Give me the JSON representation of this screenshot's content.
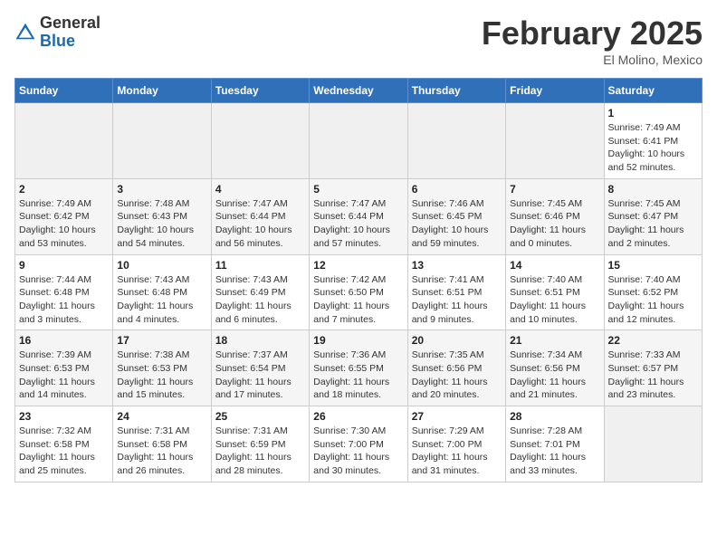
{
  "header": {
    "logo_general": "General",
    "logo_blue": "Blue",
    "title": "February 2025",
    "location": "El Molino, Mexico"
  },
  "days_of_week": [
    "Sunday",
    "Monday",
    "Tuesday",
    "Wednesday",
    "Thursday",
    "Friday",
    "Saturday"
  ],
  "weeks": [
    [
      {
        "day": "",
        "info": ""
      },
      {
        "day": "",
        "info": ""
      },
      {
        "day": "",
        "info": ""
      },
      {
        "day": "",
        "info": ""
      },
      {
        "day": "",
        "info": ""
      },
      {
        "day": "",
        "info": ""
      },
      {
        "day": "1",
        "info": "Sunrise: 7:49 AM\nSunset: 6:41 PM\nDaylight: 10 hours and 52 minutes."
      }
    ],
    [
      {
        "day": "2",
        "info": "Sunrise: 7:49 AM\nSunset: 6:42 PM\nDaylight: 10 hours and 53 minutes."
      },
      {
        "day": "3",
        "info": "Sunrise: 7:48 AM\nSunset: 6:43 PM\nDaylight: 10 hours and 54 minutes."
      },
      {
        "day": "4",
        "info": "Sunrise: 7:47 AM\nSunset: 6:44 PM\nDaylight: 10 hours and 56 minutes."
      },
      {
        "day": "5",
        "info": "Sunrise: 7:47 AM\nSunset: 6:44 PM\nDaylight: 10 hours and 57 minutes."
      },
      {
        "day": "6",
        "info": "Sunrise: 7:46 AM\nSunset: 6:45 PM\nDaylight: 10 hours and 59 minutes."
      },
      {
        "day": "7",
        "info": "Sunrise: 7:45 AM\nSunset: 6:46 PM\nDaylight: 11 hours and 0 minutes."
      },
      {
        "day": "8",
        "info": "Sunrise: 7:45 AM\nSunset: 6:47 PM\nDaylight: 11 hours and 2 minutes."
      }
    ],
    [
      {
        "day": "9",
        "info": "Sunrise: 7:44 AM\nSunset: 6:48 PM\nDaylight: 11 hours and 3 minutes."
      },
      {
        "day": "10",
        "info": "Sunrise: 7:43 AM\nSunset: 6:48 PM\nDaylight: 11 hours and 4 minutes."
      },
      {
        "day": "11",
        "info": "Sunrise: 7:43 AM\nSunset: 6:49 PM\nDaylight: 11 hours and 6 minutes."
      },
      {
        "day": "12",
        "info": "Sunrise: 7:42 AM\nSunset: 6:50 PM\nDaylight: 11 hours and 7 minutes."
      },
      {
        "day": "13",
        "info": "Sunrise: 7:41 AM\nSunset: 6:51 PM\nDaylight: 11 hours and 9 minutes."
      },
      {
        "day": "14",
        "info": "Sunrise: 7:40 AM\nSunset: 6:51 PM\nDaylight: 11 hours and 10 minutes."
      },
      {
        "day": "15",
        "info": "Sunrise: 7:40 AM\nSunset: 6:52 PM\nDaylight: 11 hours and 12 minutes."
      }
    ],
    [
      {
        "day": "16",
        "info": "Sunrise: 7:39 AM\nSunset: 6:53 PM\nDaylight: 11 hours and 14 minutes."
      },
      {
        "day": "17",
        "info": "Sunrise: 7:38 AM\nSunset: 6:53 PM\nDaylight: 11 hours and 15 minutes."
      },
      {
        "day": "18",
        "info": "Sunrise: 7:37 AM\nSunset: 6:54 PM\nDaylight: 11 hours and 17 minutes."
      },
      {
        "day": "19",
        "info": "Sunrise: 7:36 AM\nSunset: 6:55 PM\nDaylight: 11 hours and 18 minutes."
      },
      {
        "day": "20",
        "info": "Sunrise: 7:35 AM\nSunset: 6:56 PM\nDaylight: 11 hours and 20 minutes."
      },
      {
        "day": "21",
        "info": "Sunrise: 7:34 AM\nSunset: 6:56 PM\nDaylight: 11 hours and 21 minutes."
      },
      {
        "day": "22",
        "info": "Sunrise: 7:33 AM\nSunset: 6:57 PM\nDaylight: 11 hours and 23 minutes."
      }
    ],
    [
      {
        "day": "23",
        "info": "Sunrise: 7:32 AM\nSunset: 6:58 PM\nDaylight: 11 hours and 25 minutes."
      },
      {
        "day": "24",
        "info": "Sunrise: 7:31 AM\nSunset: 6:58 PM\nDaylight: 11 hours and 26 minutes."
      },
      {
        "day": "25",
        "info": "Sunrise: 7:31 AM\nSunset: 6:59 PM\nDaylight: 11 hours and 28 minutes."
      },
      {
        "day": "26",
        "info": "Sunrise: 7:30 AM\nSunset: 7:00 PM\nDaylight: 11 hours and 30 minutes."
      },
      {
        "day": "27",
        "info": "Sunrise: 7:29 AM\nSunset: 7:00 PM\nDaylight: 11 hours and 31 minutes."
      },
      {
        "day": "28",
        "info": "Sunrise: 7:28 AM\nSunset: 7:01 PM\nDaylight: 11 hours and 33 minutes."
      },
      {
        "day": "",
        "info": ""
      }
    ]
  ]
}
